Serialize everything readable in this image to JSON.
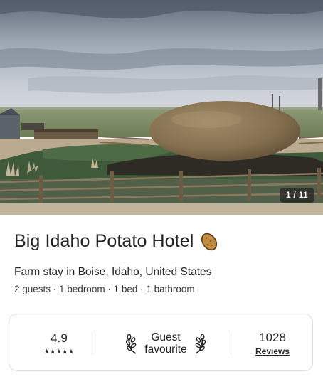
{
  "gallery": {
    "counter": "1 / 11"
  },
  "listing": {
    "title": "Big Idaho Potato Hotel",
    "title_icon": "potato-emoji",
    "subtitle": "Farm stay in Boise, Idaho, United States",
    "details": "2 guests · 1 bedroom · 1 bed · 1 bathroom"
  },
  "stats": {
    "rating": "4.9",
    "stars": "★★★★★",
    "badge_line1": "Guest",
    "badge_line2": "favourite",
    "reviews_count": "1028",
    "reviews_label": "Reviews",
    "laurel_icon": "laurel-icon"
  },
  "colors": {
    "text": "#222222",
    "border": "#dddddd",
    "potato": "#8a7352"
  }
}
